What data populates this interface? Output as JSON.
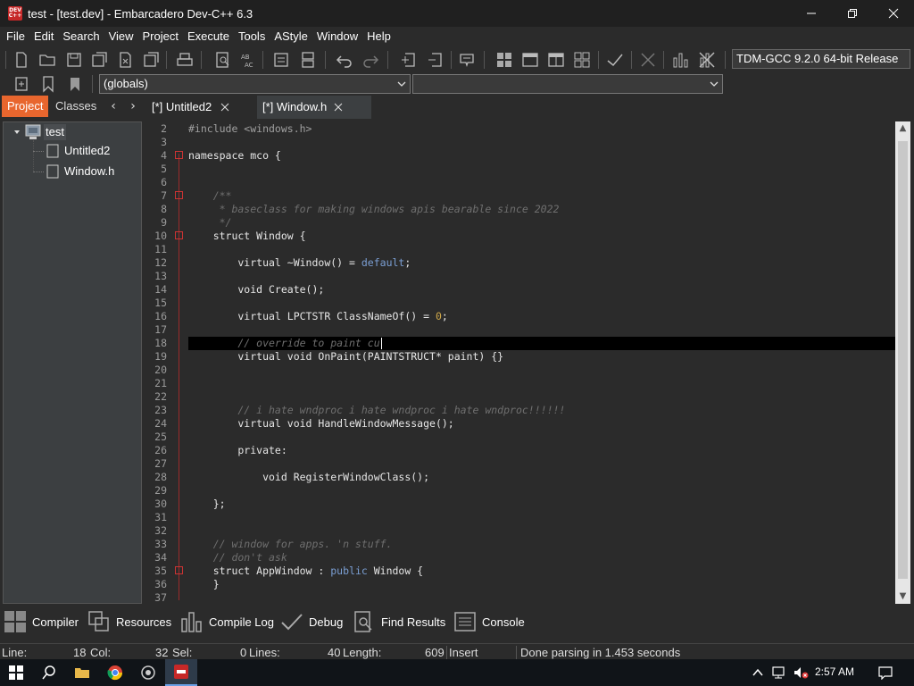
{
  "window": {
    "title": "test - [test.dev] - Embarcadero Dev-C++ 6.3",
    "app_icon_text": "DEV C++"
  },
  "menu": [
    "File",
    "Edit",
    "Search",
    "View",
    "Project",
    "Execute",
    "Tools",
    "AStyle",
    "Window",
    "Help"
  ],
  "toolbar": {
    "compiler": "TDM-GCC 9.2.0 64-bit Release",
    "scope_combo": "(globals)",
    "function_combo": ""
  },
  "left_tabs": {
    "project": "Project",
    "classes": "Classes"
  },
  "doc_tabs": [
    {
      "label": "[*] Untitled2",
      "active": false
    },
    {
      "label": "[*] Window.h",
      "active": true
    }
  ],
  "project_tree": {
    "root": "test",
    "files": [
      "Untitled2",
      "Window.h"
    ]
  },
  "editor": {
    "lines": [
      {
        "n": "2",
        "text": "#include <windows.h>"
      },
      {
        "n": "3",
        "text": ""
      },
      {
        "n": "4",
        "text": "namespace mco {"
      },
      {
        "n": "5",
        "text": ""
      },
      {
        "n": "6",
        "text": ""
      },
      {
        "n": "7",
        "text": "    /**"
      },
      {
        "n": "8",
        "text": "     * baseclass for making windows apis bearable since 2022"
      },
      {
        "n": "9",
        "text": "     */"
      },
      {
        "n": "10",
        "text": "    struct Window {"
      },
      {
        "n": "11",
        "text": ""
      },
      {
        "n": "12",
        "text": "        virtual ~Window() = default;"
      },
      {
        "n": "13",
        "text": ""
      },
      {
        "n": "14",
        "text": "        void Create();"
      },
      {
        "n": "15",
        "text": ""
      },
      {
        "n": "16",
        "text": "        virtual LPCTSTR ClassNameOf() = 0;"
      },
      {
        "n": "17",
        "text": ""
      },
      {
        "n": "18",
        "text": "        // override to paint cu"
      },
      {
        "n": "19",
        "text": "        virtual void OnPaint(PAINTSTRUCT* paint) {}"
      },
      {
        "n": "20",
        "text": ""
      },
      {
        "n": "21",
        "text": ""
      },
      {
        "n": "22",
        "text": ""
      },
      {
        "n": "23",
        "text": "        // i hate wndproc i hate wndproc i hate wndproc!!!!!!"
      },
      {
        "n": "24",
        "text": "        virtual void HandleWindowMessage();"
      },
      {
        "n": "25",
        "text": ""
      },
      {
        "n": "26",
        "text": "        private:"
      },
      {
        "n": "27",
        "text": ""
      },
      {
        "n": "28",
        "text": "            void RegisterWindowClass();"
      },
      {
        "n": "29",
        "text": ""
      },
      {
        "n": "30",
        "text": "    };"
      },
      {
        "n": "31",
        "text": ""
      },
      {
        "n": "32",
        "text": ""
      },
      {
        "n": "33",
        "text": "    // window for apps. 'n stuff."
      },
      {
        "n": "34",
        "text": "    // don't ask"
      },
      {
        "n": "35",
        "text": "    struct AppWindow : public Window {"
      },
      {
        "n": "36",
        "text": "    }"
      },
      {
        "n": "37",
        "text": ""
      }
    ]
  },
  "bottom_tabs": [
    "Compiler",
    "Resources",
    "Compile Log",
    "Debug",
    "Find Results",
    "Console"
  ],
  "status": {
    "line_label": "Line:",
    "line_value": "18",
    "col_label": "Col:",
    "col_value": "32",
    "sel_label": "Sel:",
    "sel_value": "0",
    "lines_label": "Lines:",
    "lines_value": "40",
    "length_label": "Length:",
    "length_value": "609",
    "mode": "Insert",
    "message": "Done parsing in 1.453 seconds"
  },
  "taskbar": {
    "clock": "2:57 AM"
  }
}
